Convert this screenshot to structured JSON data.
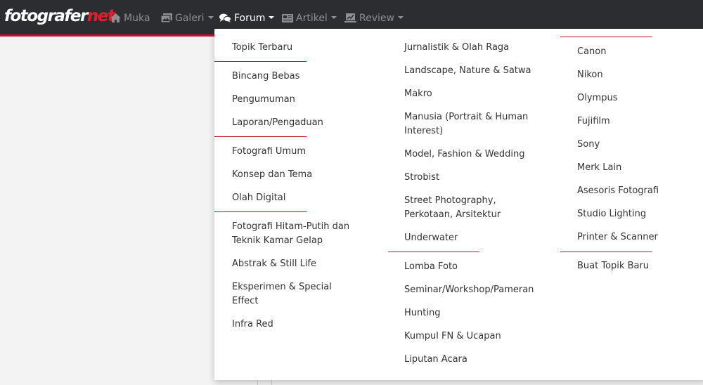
{
  "brand": {
    "name_main": "fotografer",
    "name_accent": "net"
  },
  "nav": {
    "items": [
      {
        "label": "Muka",
        "icon": "home-icon"
      },
      {
        "label": "Galeri",
        "icon": "image-icon"
      },
      {
        "label": "Forum",
        "icon": "comments-icon"
      },
      {
        "label": "Artikel",
        "icon": "newspaper-icon"
      },
      {
        "label": "Review",
        "icon": "review-icon"
      }
    ]
  },
  "forum_menu": {
    "col1": {
      "items": [
        "Topik Terbaru",
        "Bincang Bebas",
        "Pengumuman",
        "Laporan/Pengaduan",
        "Fotografi Umum",
        "Konsep dan Tema",
        "Olah Digital",
        "Fotografi Hitam-Putih dan Teknik Kamar Gelap",
        "Abstrak & Still Life",
        "Eksperimen & Special Effect",
        "Infra Red"
      ]
    },
    "col2": {
      "items": [
        "Jurnalistik & Olah Raga",
        "Landscape, Nature & Satwa",
        "Makro",
        "Manusia (Portrait & Human Interest)",
        "Model, Fashion & Wedding",
        "Strobist",
        "Street Photography, Perkotaan, Arsitektur",
        "Underwater",
        "Lomba Foto",
        "Seminar/Workshop/Pameran",
        "Hunting",
        "Kumpul FN & Ucapan",
        "Liputan Acara"
      ]
    },
    "col3": {
      "items": [
        "Canon",
        "Nikon",
        "Olympus",
        "Fujifilm",
        "Sony",
        "Merk Lain",
        "Asesoris Fotografi",
        "Studio Lighting",
        "Printer & Scanner",
        "Buat Topik Baru"
      ]
    }
  },
  "colors": {
    "navbar": "#2b2d31",
    "accent": "#c8102e",
    "nav_text": "#8c8f94",
    "menu_text": "#333333"
  }
}
